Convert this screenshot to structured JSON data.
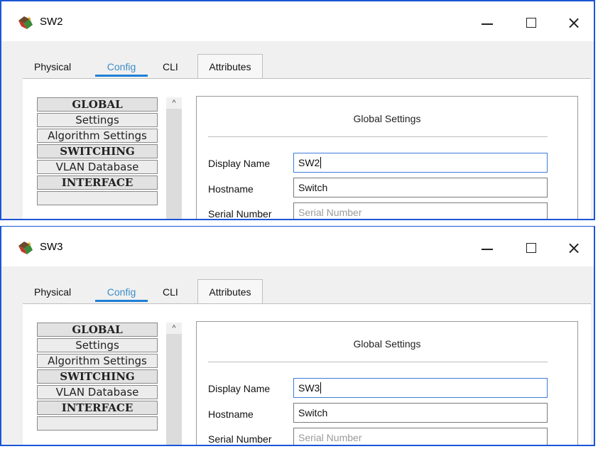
{
  "windows": [
    {
      "title": "SW2",
      "tabs": [
        "Physical",
        "Config",
        "CLI",
        "Attributes"
      ],
      "nav_items": [
        "GLOBAL",
        "Settings",
        "Algorithm Settings",
        "SWITCHING",
        "VLAN Database",
        "INTERFACE"
      ],
      "scroll_up": "^",
      "panel_title": "Global Settings",
      "fields": [
        {
          "label": "Display Name",
          "value": "SW2"
        },
        {
          "label": "Hostname",
          "value": "Switch"
        },
        {
          "label": "Serial Number",
          "placeholder": "Serial Number"
        }
      ]
    },
    {
      "title": "SW3",
      "tabs": [
        "Physical",
        "Config",
        "CLI",
        "Attributes"
      ],
      "nav_items": [
        "GLOBAL",
        "Settings",
        "Algorithm Settings",
        "SWITCHING",
        "VLAN Database",
        "INTERFACE"
      ],
      "scroll_up": "^",
      "panel_title": "Global Settings",
      "fields": [
        {
          "label": "Display Name",
          "value": "SW3"
        },
        {
          "label": "Hostname",
          "value": "Switch"
        },
        {
          "label": "Serial Number",
          "placeholder": "Serial Number"
        }
      ]
    }
  ],
  "controls": {
    "minimize": "minimize-icon",
    "maximize": "maximize-icon",
    "close_glyph": "×"
  },
  "colors": {
    "window_border": "#1a56d6",
    "active_tab": "#3a8ec8",
    "tab_underline": "#1e7fd8",
    "focus_border": "#3d7bd9"
  }
}
